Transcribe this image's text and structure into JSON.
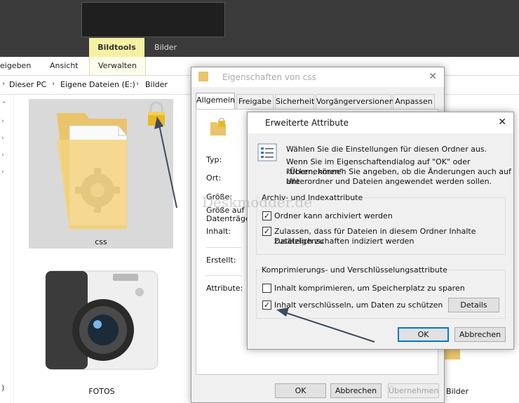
{
  "ribbon": {
    "tab_freigeben": "eigeben",
    "tab_ansicht": "Ansicht",
    "ctx_bildtools": "Bildtools",
    "ctx_bilder": "Bilder",
    "tab_verwalten": "Verwalten"
  },
  "breadcrumb": {
    "items": [
      "Dieser PC",
      "Eigene Dateien (E:)",
      "Bilder"
    ]
  },
  "files": {
    "css_label": "css",
    "fotos_label": "FOTOS",
    "bilder_label": "Bilder",
    "edge_char": ")"
  },
  "props_dialog": {
    "title": "Eigenschaften von css",
    "tabs": [
      "Allgemein",
      "Freigabe",
      "Sicherheit",
      "Vorgängerversionen",
      "Anpassen"
    ],
    "labels": {
      "typ": "Typ:",
      "ort": "Ort:",
      "groesse": "Größe:",
      "groesse_datentraeger_1": "Größe auf",
      "groesse_datentraeger_2": "Datenträger:",
      "inhalt": "Inhalt:",
      "erstellt": "Erstellt:",
      "attribute": "Attribute:"
    },
    "buttons": {
      "ok": "OK",
      "abbrechen": "Abbrechen",
      "uebernehmen": "Übernehmen"
    }
  },
  "attr_dialog": {
    "title": "Erweiterte Attribute",
    "intro": "Wählen Sie die Einstellungen für diesen Ordner aus.",
    "detail_1": "Wenn Sie im Eigenschaftendialog auf \"OK\" oder \"Übernehmen\"",
    "detail_2": "klicken, können Sie angeben, ob die Änderungen auch auf alle",
    "detail_3": "Unterordner und Dateien angewendet werden sollen.",
    "group_archive": "Archiv- und Indexattribute",
    "cb_archive": "Ordner kann archiviert werden",
    "cb_index_1": "Zulassen, dass für Dateien in diesem Ordner Inhalte zusätzlich zu",
    "cb_index_2": "Dateieigenschaften indiziert werden",
    "group_compress": "Komprimierungs- und Verschlüsselungsattribute",
    "cb_compress": "Inhalt komprimieren, um Speicherplatz zu sparen",
    "cb_encrypt": "Inhalt verschlüsseln, um Daten zu schützen",
    "checked": {
      "archive": true,
      "index": true,
      "compress": false,
      "encrypt": true
    },
    "buttons": {
      "details": "Details",
      "ok": "OK",
      "abbrechen": "Abbrechen"
    }
  },
  "watermark": "Deskmodder.de",
  "colors": {
    "accent": "#0078d7",
    "ctx_tab": "#f6f1a2",
    "lock": "#e8b923"
  },
  "icons": [
    "lock-icon",
    "folder-icon",
    "camera-icon",
    "close-icon",
    "checkbox-icon",
    "properties-list-icon"
  ]
}
